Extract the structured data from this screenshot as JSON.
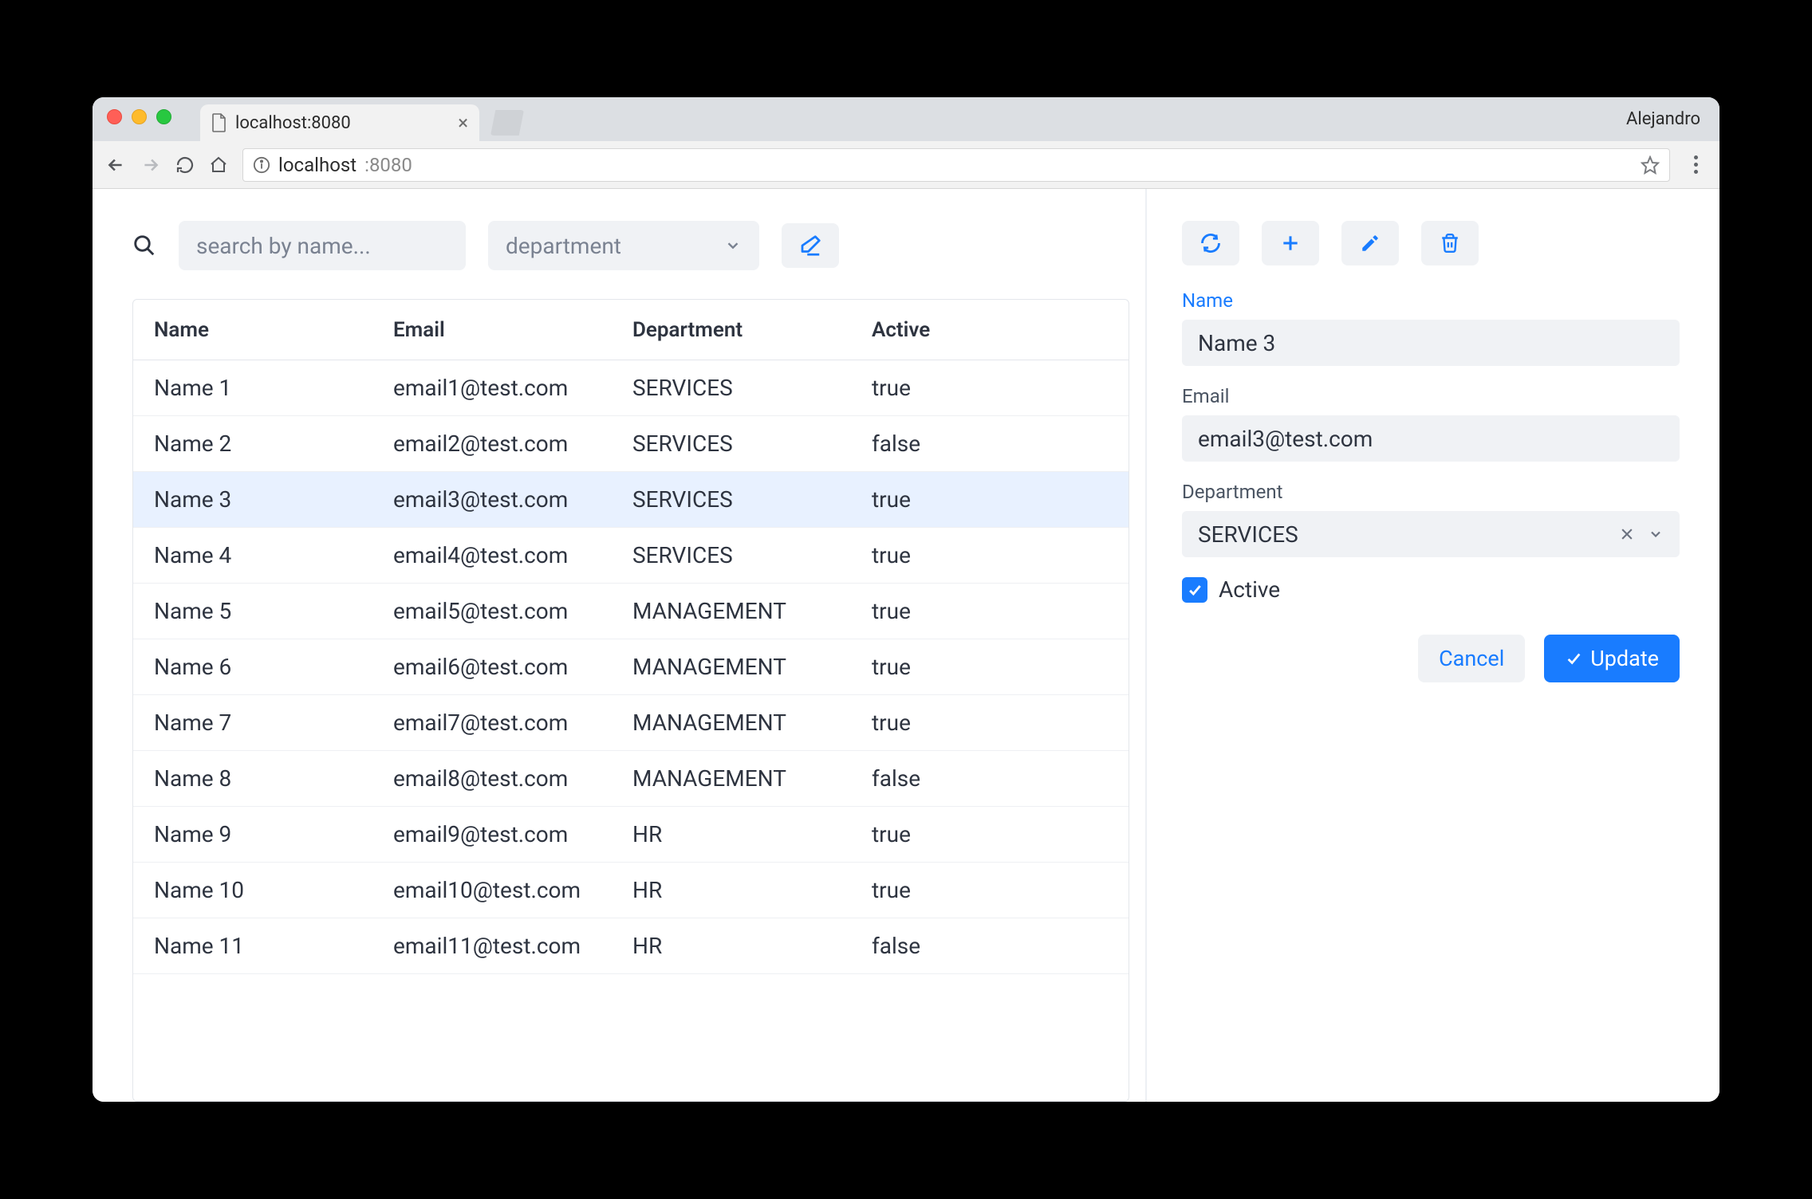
{
  "browser": {
    "tab_title": "localhost:8080",
    "profile": "Alejandro",
    "url_host": "localhost",
    "url_port": ":8080"
  },
  "filters": {
    "search_placeholder": "search by name...",
    "department_placeholder": "department"
  },
  "table": {
    "headers": {
      "name": "Name",
      "email": "Email",
      "department": "Department",
      "active": "Active"
    },
    "rows": [
      {
        "name": "Name 1",
        "email": "email1@test.com",
        "department": "SERVICES",
        "active": "true"
      },
      {
        "name": "Name 2",
        "email": "email2@test.com",
        "department": "SERVICES",
        "active": "false"
      },
      {
        "name": "Name 3",
        "email": "email3@test.com",
        "department": "SERVICES",
        "active": "true"
      },
      {
        "name": "Name 4",
        "email": "email4@test.com",
        "department": "SERVICES",
        "active": "true"
      },
      {
        "name": "Name 5",
        "email": "email5@test.com",
        "department": "MANAGEMENT",
        "active": "true"
      },
      {
        "name": "Name 6",
        "email": "email6@test.com",
        "department": "MANAGEMENT",
        "active": "true"
      },
      {
        "name": "Name 7",
        "email": "email7@test.com",
        "department": "MANAGEMENT",
        "active": "true"
      },
      {
        "name": "Name 8",
        "email": "email8@test.com",
        "department": "MANAGEMENT",
        "active": "false"
      },
      {
        "name": "Name 9",
        "email": "email9@test.com",
        "department": "HR",
        "active": "true"
      },
      {
        "name": "Name 10",
        "email": "email10@test.com",
        "department": "HR",
        "active": "true"
      },
      {
        "name": "Name 11",
        "email": "email11@test.com",
        "department": "HR",
        "active": "false"
      }
    ],
    "selected_index": 2
  },
  "form": {
    "labels": {
      "name": "Name",
      "email": "Email",
      "department": "Department",
      "active": "Active"
    },
    "values": {
      "name": "Name 3",
      "email": "email3@test.com",
      "department": "SERVICES",
      "active": true
    },
    "buttons": {
      "cancel": "Cancel",
      "update": "Update"
    }
  },
  "colors": {
    "accent": "#197cff"
  }
}
